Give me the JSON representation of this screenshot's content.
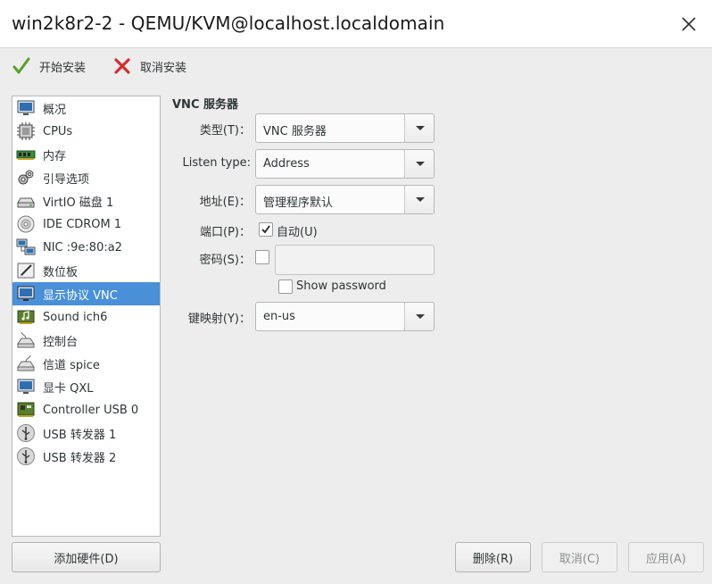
{
  "window": {
    "title": "win2k8r2-2 - QEMU/KVM@localhost.localdomain"
  },
  "toolbar": {
    "begin_install": "开始安装",
    "cancel_install": "取消安装"
  },
  "sidebar": {
    "items": [
      {
        "label": "概况",
        "icon": "monitor-icon"
      },
      {
        "label": "CPUs",
        "icon": "cpu-icon"
      },
      {
        "label": "内存",
        "icon": "memory-icon"
      },
      {
        "label": "引导选项",
        "icon": "boot-options-icon"
      },
      {
        "label": "VirtIO 磁盘 1",
        "icon": "disk-icon"
      },
      {
        "label": "IDE CDROM 1",
        "icon": "cdrom-icon"
      },
      {
        "label": "NIC :9e:80:a2",
        "icon": "network-icon"
      },
      {
        "label": "数位板",
        "icon": "tablet-icon"
      },
      {
        "label": "显示协议 VNC",
        "icon": "display-icon",
        "selected": true
      },
      {
        "label": "Sound ich6",
        "icon": "sound-card-icon"
      },
      {
        "label": "控制台",
        "icon": "console-icon"
      },
      {
        "label": "信道 spice",
        "icon": "channel-icon"
      },
      {
        "label": "显卡 QXL",
        "icon": "video-card-icon"
      },
      {
        "label": "Controller USB 0",
        "icon": "controller-icon"
      },
      {
        "label": "USB 转发器 1",
        "icon": "usb-icon"
      },
      {
        "label": "USB 转发器 2",
        "icon": "usb-icon"
      }
    ],
    "add_hardware": "添加硬件(D)"
  },
  "vnc": {
    "section_title": "VNC 服务器",
    "type_label": "类型(T)：",
    "type_value": "VNC 服务器",
    "listen_label": "Listen type:",
    "listen_value": "Address",
    "address_label": "地址(E)：",
    "address_value": "管理程序默认",
    "port_label": "端口(P)：",
    "port_auto_label": "自动(U)",
    "port_auto_checked": true,
    "password_label": "密码(S)：",
    "password_checked": false,
    "password_value": "",
    "show_password_label": "Show password",
    "show_password_checked": false,
    "keymap_label": "键映射(Y)：",
    "keymap_value": "en-us"
  },
  "buttons": {
    "remove": "删除(R)",
    "cancel": "取消(C)",
    "apply": "应用(A)"
  },
  "colors": {
    "selection": "#4a90d9",
    "accept_green": "#5aa02c",
    "cancel_red": "#d32f2f"
  }
}
